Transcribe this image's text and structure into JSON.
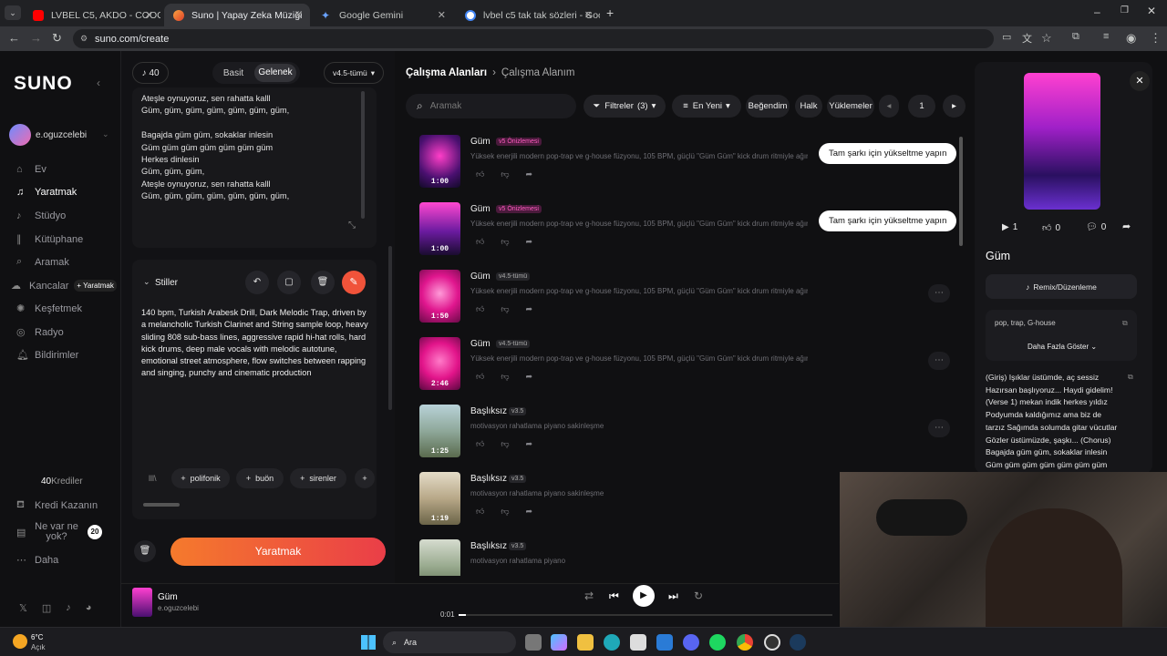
{
  "browser": {
    "tabs": [
      {
        "title": "LVBEL C5, AKDO - COOOK PAR..."
      },
      {
        "title": "Suno | Yapay Zeka Müziği"
      },
      {
        "title": "Google Gemini"
      },
      {
        "title": "lvbel c5 tak tak sözleri - Google..."
      }
    ],
    "url": "suno.com/create"
  },
  "sidebar": {
    "logo": "SUNO",
    "user": "e.oguzcelebi",
    "items": [
      {
        "label": "Ev"
      },
      {
        "label": "Yaratmak"
      },
      {
        "label": "Stüdyo"
      },
      {
        "label": "Kütüphane"
      },
      {
        "label": "Aramak"
      },
      {
        "label": "Kancalar"
      },
      {
        "label": "Keşfetmek"
      },
      {
        "label": "Radyo"
      },
      {
        "label": "Bildirimler"
      }
    ],
    "kancalar_badge": "+ Yaratmak",
    "credits_value": "40",
    "credits_label": "Krediler",
    "earn": "Kredi Kazanın",
    "whatsnew": "Ne var ne yok?",
    "whatsnew_count": "20",
    "more": "Daha"
  },
  "create": {
    "credits": "40",
    "tab_simple": "Basit",
    "tab_custom": "Gelenek",
    "model": "v4.5-tümü",
    "lyrics": "Ateşle oynuyoruz, sen rahatta kalll\nGüm, güm, güm, güm, güm, güm, güm,\n\nBagajda güm güm, sokaklar inlesin\nGüm güm güm güm güm güm güm\nHerkes dinlesin\nGüm, güm, güm,\nAteşle oynuyoruz, sen rahatta kalll\nGüm, güm, güm, güm, güm, güm, güm,",
    "styles_label": "Stiller",
    "styles_text": "140 bpm, Turkish Arabesk Drill, Dark Melodic Trap, driven by a melancholic Turkish Clarinet and String sample loop, heavy sliding 808 sub-bass lines, aggressive rapid hi-hat rolls, hard kick drums, deep male vocals with melodic autotune, emotional street atmosphere, flow switches between rapping and singing, punchy and cinematic production",
    "tags": [
      "polifonik",
      "buön",
      "sirenler"
    ],
    "create_button": "Yaratmak"
  },
  "workspace": {
    "breadcrumb_root": "Çalışma Alanları",
    "breadcrumb_current": "Çalışma Alanım",
    "search_placeholder": "Aramak",
    "filters": "Filtreler",
    "filters_count": "(3)",
    "sort": "En Yeni",
    "liked": "Beğendim",
    "public": "Halk",
    "uploads": "Yüklemeler",
    "page": "1",
    "songs": [
      {
        "title": "Güm",
        "badge": "v5 Önizlemesi",
        "desc": "Yüksek enerjili modern pop-trap ve g-house füzyonu, 105 BPM, güçlü \"Güm Güm\" kick drum ritmiyle ağır dist...",
        "duration": "1:00",
        "upgrade": "Tam şarkı için yükseltme yapın"
      },
      {
        "title": "Güm",
        "badge": "v5 Önizlemesi",
        "desc": "Yüksek enerjili modern pop-trap ve g-house füzyonu, 105 BPM, güçlü \"Güm Güm\" kick drum ritmiyle ağır dist...",
        "duration": "1:00",
        "upgrade": "Tam şarkı için yükseltme yapın"
      },
      {
        "title": "Güm",
        "badge": "v4.5-tümü",
        "desc": "Yüksek enerjili modern pop-trap ve g-house füzyonu, 105 BPM, güçlü \"Güm Güm\" kick drum ritmiyle ağır dist...",
        "duration": "1:50",
        "upgrade": ""
      },
      {
        "title": "Güm",
        "badge": "v4.5-tümü",
        "desc": "Yüksek enerjili modern pop-trap ve g-house füzyonu, 105 BPM, güçlü \"Güm Güm\" kick drum ritmiyle ağır dist...",
        "duration": "2:46",
        "upgrade": ""
      },
      {
        "title": "Başlıksız",
        "badge": "v3.5",
        "desc": "motivasyon rahatlama piyano sakinleşme",
        "duration": "1:25",
        "upgrade": ""
      },
      {
        "title": "Başlıksız",
        "badge": "v3.5",
        "desc": "motivasyon rahatlama piyano sakinleşme",
        "duration": "1:19",
        "upgrade": ""
      },
      {
        "title": "Başlıksız",
        "badge": "v3.5",
        "desc": "motivasyon rahatlama piyano",
        "duration": "",
        "upgrade": ""
      }
    ]
  },
  "detail": {
    "plays": "1",
    "likes": "0",
    "comments": "0",
    "title": "Güm",
    "remix": "Remix/Düzenleme",
    "tags": "pop, trap, G-house",
    "show_more": "Daha Fazla Göster",
    "lyrics": "(Giriş) Işıklar üstümde, aç sessiz Hazırsan başlıyoruz... Haydi gidelim! (Verse 1) mekan indik herkes yıldız Podyumda kaldığımız ama biz de tarzız Sağımda solumda gitar vücutlar Gözler üstümüzde, şaşkı... (Chorus) Bagajda güm güm, sokaklar inlesin Güm güm güm güm güm güm güm"
  },
  "player": {
    "title": "Güm",
    "artist": "e.oguzcelebi",
    "time": "0:01"
  },
  "taskbar": {
    "weather_temp": "6°C",
    "weather_desc": "Açık",
    "search": "Ara"
  },
  "colors": {
    "accent": "#f0533a",
    "badge_v5": "#e63aa0"
  }
}
